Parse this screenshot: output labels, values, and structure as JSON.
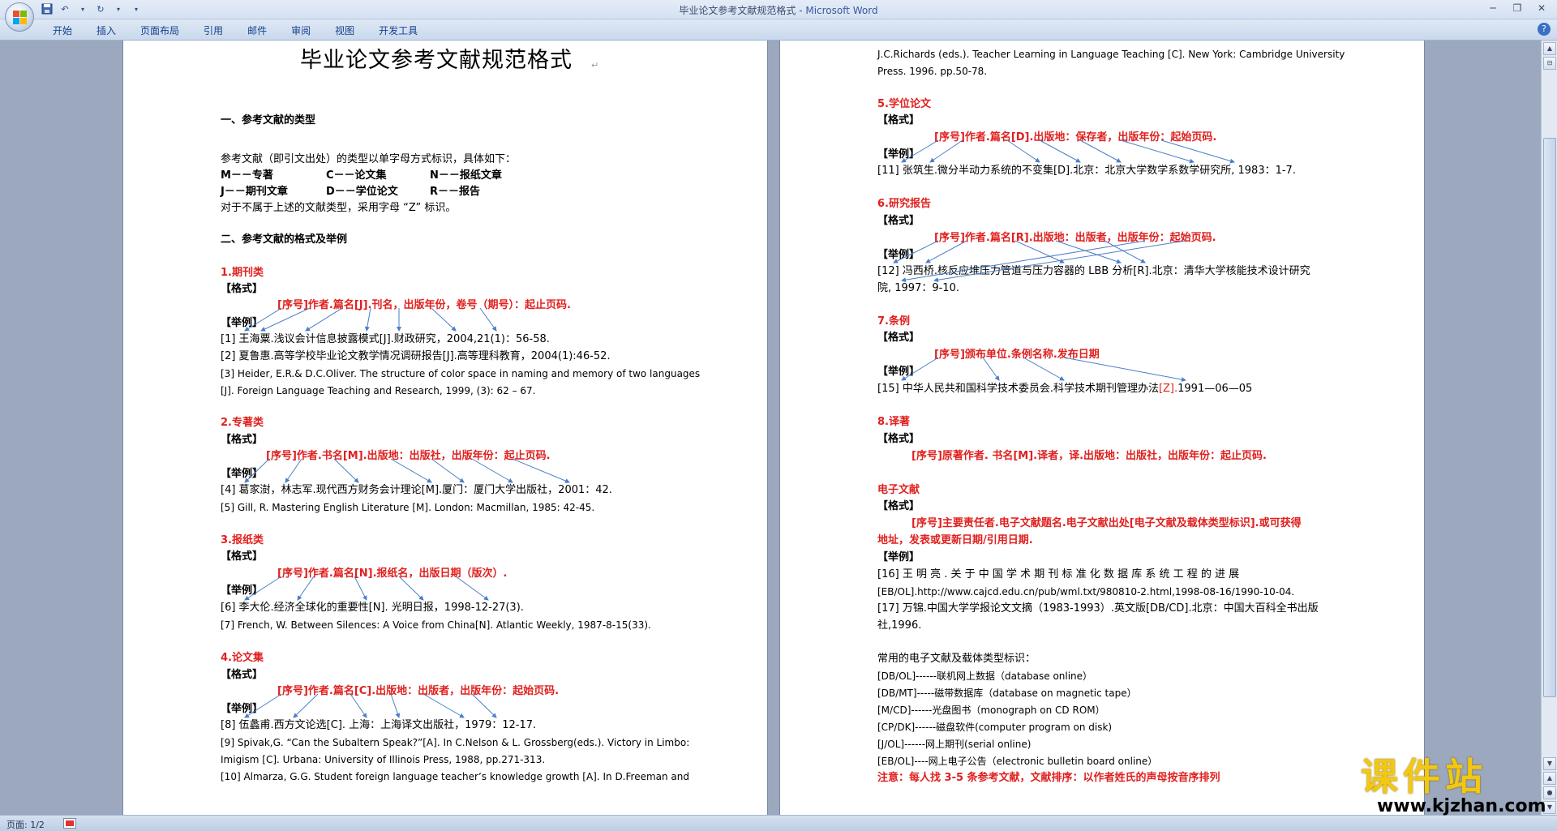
{
  "window": {
    "title": "毕业论文参考文献规范格式",
    "app_name": "Microsoft Word",
    "separator": " - "
  },
  "ribbon": {
    "tabs": [
      "开始",
      "插入",
      "页面布局",
      "引用",
      "邮件",
      "审阅",
      "视图",
      "开发工具"
    ]
  },
  "status": {
    "page": "页面: 1/2"
  },
  "watermark": {
    "cn": "课件站",
    "url": "www.kjzhan.com"
  },
  "doc": {
    "title": "毕业论文参考文献规范格式",
    "p1": {
      "h1": "一、参考文献的类型",
      "intro": "参考文献（即引文出处）的类型以单字母方式标识，具体如下：",
      "types_r1": [
        "M－－专著",
        "C－－论文集",
        "N－－报纸文章"
      ],
      "types_r2": [
        "J－－期刊文章",
        "D－－学位论文",
        "R－－报告"
      ],
      "other": "对于不属于上述的文献类型，采用字母 “Z” 标识。",
      "h2": "二、参考文献的格式及举例",
      "s1": "1.期刊类",
      "fmt": "【格式】",
      "ex": "【举例】",
      "s1_fmt": "[序号]作者.篇名[J].刊名，出版年份，卷号（期号）：起止页码.",
      "s1_e1": "[1]  王海粟.浅议会计信息披露模式[J].财政研究，2004,21(1)：56-58.",
      "s1_e2": "[2]  夏鲁惠.高等学校毕业论文教学情况调研报告[J].高等理科教育，2004(1):46-52.",
      "s1_e3a": "[3] Heider, E.R.& D.C.Oliver. The structure of color space in naming and memory of two languages",
      "s1_e3b": "[J]. Foreign Language Teaching and Research, 1999, (3): 62 – 67.",
      "s2": "2.专著类",
      "s2_fmt": "[序号]作者.书名[M].出版地：出版社，出版年份：起止页码.",
      "s2_e1": "[4]  葛家澍，林志军.现代西方财务会计理论[M].厦门：厦门大学出版社，2001：42.",
      "s2_e2": "[5] Gill, R. Mastering English Literature [M]. London:  Macmillan, 1985: 42-45.",
      "s3": "3.报纸类",
      "s3_fmt": "[序号]作者.篇名[N].报纸名，出版日期（版次）.",
      "s3_e1": "[6]  李大伦.经济全球化的重要性[N]. 光明日报，1998-12-27(3).",
      "s3_e2": "[7] French, W. Between Silences: A Voice from China[N]. Atlantic Weekly,  1987-8-15(33).",
      "s4": "4.论文集",
      "s4_fmt": "[序号]作者.篇名[C].出版地：出版者，出版年份：起始页码.",
      "s4_e1": "[8]  伍蠡甫.西方文论选[C]. 上海：上海译文出版社，1979：12-17.",
      "s4_e2a": "[9] Spivak,G. “Can the Subaltern Speak?”[A]. In C.Nelson & L. Grossberg(eds.). Victory in Limbo:",
      "s4_e2b": "Imigism [C]. Urbana: University of Illinois Press, 1988, pp.271-313.",
      "s4_e3": "[10] Almarza, G.G. Student foreign language teacher’s knowledge growth [A]. In D.Freeman and"
    },
    "p2": {
      "cont_a": "J.C.Richards (eds.). Teacher Learning in Language Teaching [C]. New York: Cambridge University",
      "cont_b": "Press. 1996. pp.50-78.",
      "s5": "5.学位论文",
      "fmt": "【格式】",
      "ex": "【举例】",
      "s5_fmt": "[序号]作者.篇名[D].出版地：保存者，出版年份：起始页码.",
      "s5_e1": "[11]  张筑生.微分半动力系统的不变集[D].北京：北京大学数学系数学研究所, 1983：1-7.",
      "s6": "6.研究报告",
      "s6_fmt": "[序号]作者.篇名[R].出版地：出版者，出版年份：起始页码.",
      "s6_e1a": "[12]  冯西桥.核反应堆压力管道与压力容器的 LBB 分析[R].北京：清华大学核能技术设计研究",
      "s6_e1b": "院, 1997：9-10.",
      "s7": "7.条例",
      "s7_fmt": "[序号]颁布单位.条例名称.发布日期",
      "s7_e1_pre": "[15]  中华人民共和国科学技术委员会.科学技术期刊管理办法",
      "s7_e1_z": "[Z].",
      "s7_e1_post": "1991—06—05",
      "s8": "8.译著",
      "s8_fmt": "[序号]原著作者. 书名[M].译者，译.出版地：出版社，出版年份：起止页码.",
      "s9": "电子文献",
      "s9_fmt_a": "[序号]主要责任者.电子文献题名.电子文献出处[电子文献及载体类型标识].或可获得",
      "s9_fmt_b": "地址，发表或更新日期/引用日期.",
      "s9_e1a": "[16] 王 明 亮 . 关 于 中 国 学 术 期 刊 标 准 化 数 据 库 系 统 工 程 的 进 展",
      "s9_e1b": "[EB/OL].http://www.cajcd.edu.cn/pub/wml.txt/980810-2.html,1998-08-16/1990-10-04.",
      "s9_e2a": "[17]  万锦.中国大学学报论文文摘（1983-1993）.英文版[DB/CD].北京：中国大百科全书出版",
      "s9_e2b": "社,1996.",
      "common": "常用的电子文献及载体类型标识：",
      "c1": "[DB/OL]------联机网上数据（database online）",
      "c2": "[DB/MT]-----磁带数据库（database on magnetic tape）",
      "c3": "[M/CD]------光盘图书（monograph on CD ROM）",
      "c4": "[CP/DK]------磁盘软件(computer program on disk)",
      "c5": "[J/OL]------网上期刊(serial online)",
      "c6": "[EB/OL]----网上电子公告（electronic bulletin board online）",
      "note": "注意：每人找 3-5 条参考文献，文献排序：以作者姓氏的声母按音序排列"
    }
  },
  "icons": {
    "save": "save-icon",
    "undo": "undo-icon",
    "redo": "redo-icon",
    "customize": "chevron-down-icon",
    "minimize": "minimize-icon",
    "restore": "restore-icon",
    "close": "close-icon"
  },
  "colors": {
    "heading_red": "#e0201e",
    "arrow_blue": "#4a7fc8",
    "ribbon_blue": "#15428b",
    "watermark_yellow": "#f2c811"
  }
}
